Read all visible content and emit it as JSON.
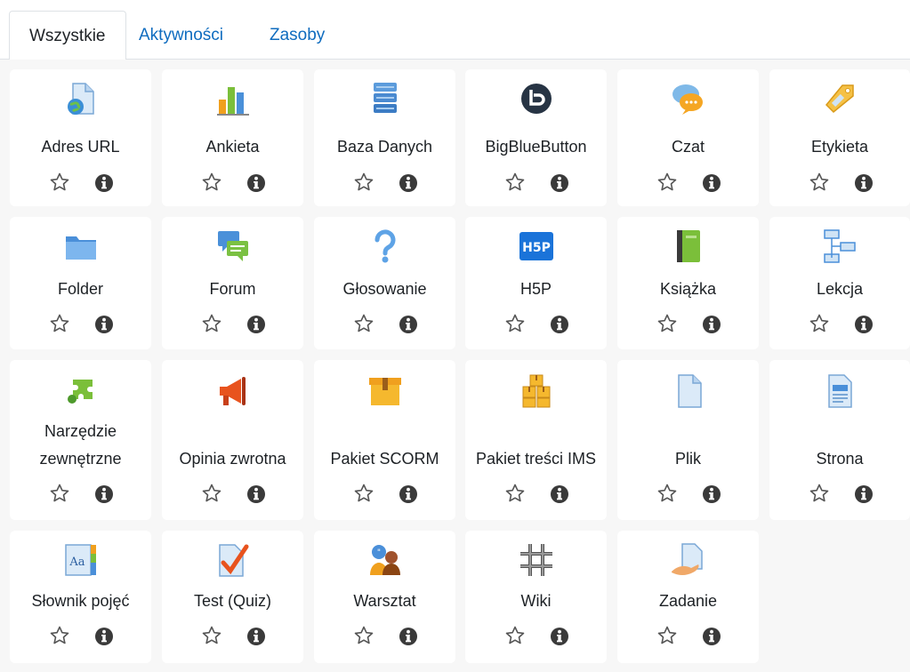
{
  "tabs": [
    {
      "label": "Wszystkie",
      "active": true
    },
    {
      "label": "Aktywności",
      "active": false
    },
    {
      "label": "Zasoby",
      "active": false
    }
  ],
  "modules": [
    {
      "label": "Adres URL",
      "icon": "url-icon"
    },
    {
      "label": "Ankieta",
      "icon": "survey-icon"
    },
    {
      "label": "Baza Danych",
      "icon": "database-icon"
    },
    {
      "label": "BigBlueButton",
      "icon": "bigbluebutton-icon"
    },
    {
      "label": "Czat",
      "icon": "chat-icon"
    },
    {
      "label": "Etykieta",
      "icon": "label-icon"
    },
    {
      "label": "Folder",
      "icon": "folder-icon"
    },
    {
      "label": "Forum",
      "icon": "forum-icon"
    },
    {
      "label": "Głosowanie",
      "icon": "choice-icon"
    },
    {
      "label": "H5P",
      "icon": "h5p-icon",
      "icon_text": "H5P"
    },
    {
      "label": "Książka",
      "icon": "book-icon"
    },
    {
      "label": "Lekcja",
      "icon": "lesson-icon"
    },
    {
      "label": "Narzędzie zewnętrzne",
      "icon": "external-tool-icon"
    },
    {
      "label": "Opinia zwrotna",
      "icon": "feedback-icon"
    },
    {
      "label": "Pakiet SCORM",
      "icon": "scorm-icon"
    },
    {
      "label": "Pakiet treści IMS",
      "icon": "ims-package-icon"
    },
    {
      "label": "Plik",
      "icon": "file-icon"
    },
    {
      "label": "Strona",
      "icon": "page-icon"
    },
    {
      "label": "Słownik pojęć",
      "icon": "glossary-icon",
      "icon_text": "Aa"
    },
    {
      "label": "Test (Quiz)",
      "icon": "quiz-icon"
    },
    {
      "label": "Warsztat",
      "icon": "workshop-icon"
    },
    {
      "label": "Wiki",
      "icon": "wiki-icon"
    },
    {
      "label": "Zadanie",
      "icon": "assignment-icon"
    }
  ],
  "actions": {
    "star_icon": "star-outline-icon",
    "info_icon": "info-icon"
  },
  "colors": {
    "link": "#0f6cbf",
    "text": "#1d2125",
    "background": "#f7f7f7",
    "tile": "#ffffff"
  }
}
